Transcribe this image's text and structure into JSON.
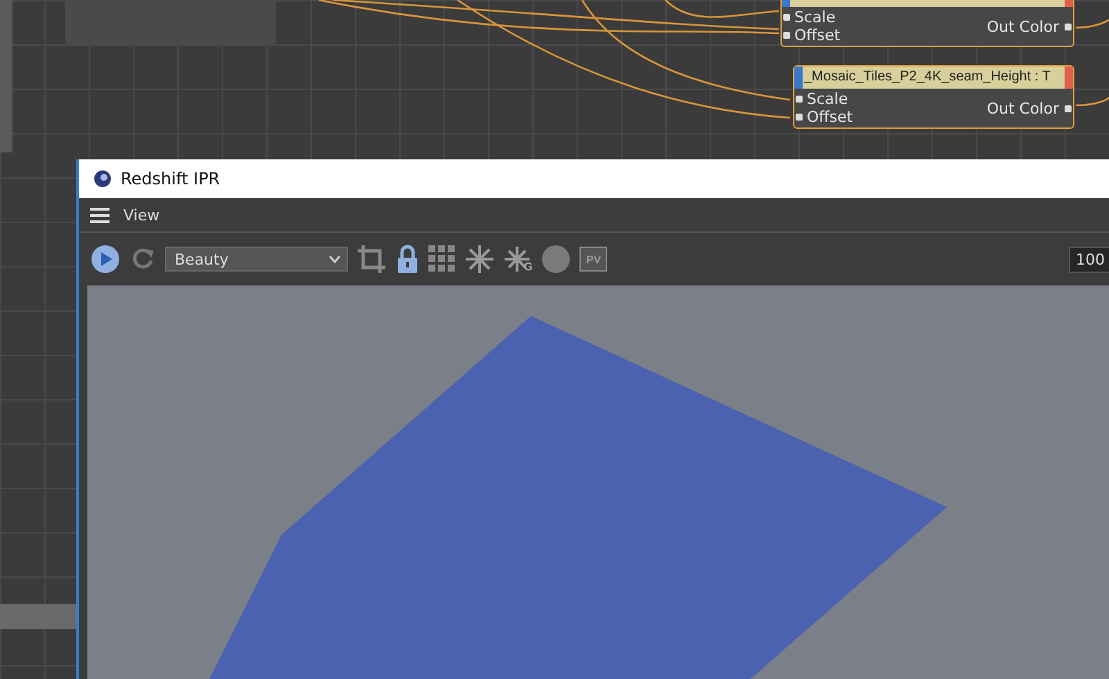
{
  "node_editor": {
    "nodes": [
      {
        "inputs": [
          "Scale",
          "Offset"
        ],
        "output": "Out Color"
      },
      {
        "title": "_Mosaic_Tiles_P2_4K_seam_Height : T",
        "inputs": [
          "Scale",
          "Offset"
        ],
        "output": "Out Color"
      }
    ]
  },
  "ipr_window": {
    "title": "Redshift IPR",
    "menu": [
      "View"
    ],
    "toolbar": {
      "playing": true,
      "aov": "Beauty",
      "locked": true,
      "snowflake_g_label": "G",
      "pv_label": "PV",
      "zoom": "100"
    }
  }
}
